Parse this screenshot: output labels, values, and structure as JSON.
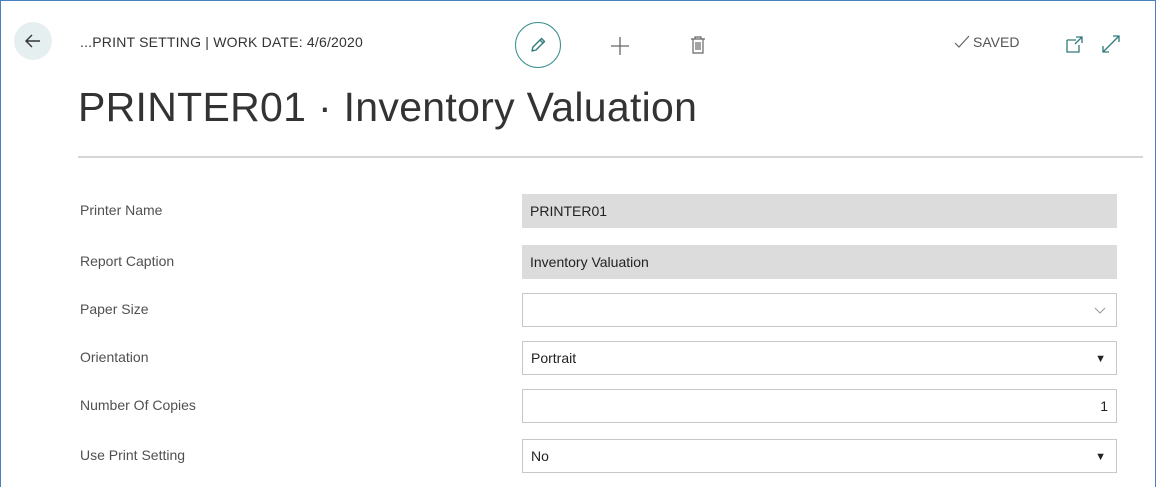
{
  "header": {
    "breadcrumb": "...PRINT SETTING | WORK DATE: 4/6/2020",
    "status": "SAVED",
    "title": "PRINTER01 · Inventory Valuation"
  },
  "fields": [
    {
      "label": "Printer Name",
      "value": "PRINTER01"
    },
    {
      "label": "Report Caption",
      "value": "Inventory Valuation"
    },
    {
      "label": "Paper Size",
      "value": ""
    },
    {
      "label": "Orientation",
      "value": "Portrait"
    },
    {
      "label": "Number Of Copies",
      "value": "1"
    },
    {
      "label": "Use Print Setting",
      "value": "No"
    }
  ],
  "icons": {
    "back": "arrow-left-icon",
    "edit": "pencil-icon",
    "new": "plus-icon",
    "delete": "trash-icon",
    "saved": "checkmark-icon",
    "popout": "open-new-window-icon",
    "expand": "expand-icon"
  },
  "colors": {
    "accent": "#3a8f8f",
    "readonly_bg": "#dcdcdc",
    "frame_border": "#4a7fc1"
  }
}
